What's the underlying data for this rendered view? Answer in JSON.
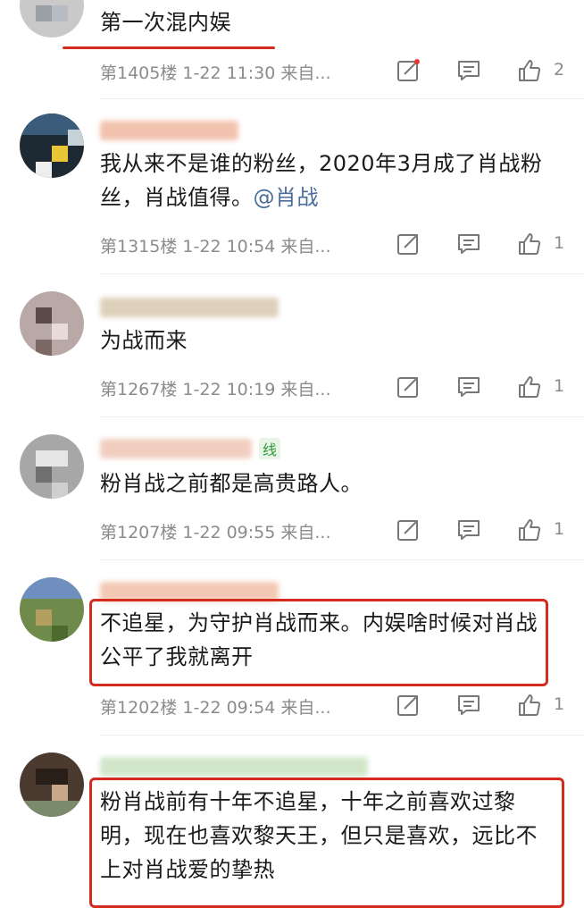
{
  "comments": [
    {
      "text": "第一次混内娱",
      "floor": "第1405楼",
      "date": "1-22",
      "time": "11:30",
      "source": "来自...",
      "likes": "2"
    },
    {
      "text": "我从来不是谁的粉丝，2020年3月成了肖战粉丝，肖战值得。",
      "mention": "@肖战",
      "floor": "第1315楼",
      "date": "1-22",
      "time": "10:54",
      "source": "来自...",
      "likes": "1"
    },
    {
      "text": "为战而来",
      "floor": "第1267楼",
      "date": "1-22",
      "time": "10:19",
      "source": "来自...",
      "likes": "1"
    },
    {
      "text": "粉肖战之前都是高贵路人。",
      "name_suffix": "线",
      "floor": "第1207楼",
      "date": "1-22",
      "time": "09:55",
      "source": "来自...",
      "likes": "1"
    },
    {
      "text": "不追星，为守护肖战而来。内娱啥时候对肖战公平了我就离开",
      "floor": "第1202楼",
      "date": "1-22",
      "time": "09:54",
      "source": "来自...",
      "likes": "1"
    },
    {
      "text": "粉肖战前有十年不追星，十年之前喜欢过黎明，现在也喜欢黎天王，但只是喜欢，远比不上对肖战爱的挚热"
    }
  ],
  "colors": {
    "highlight": "#d42b1f",
    "mention": "#4a6c9a",
    "meta": "#8b8b8b"
  },
  "icons": [
    "share-icon",
    "comment-icon",
    "like-icon"
  ]
}
